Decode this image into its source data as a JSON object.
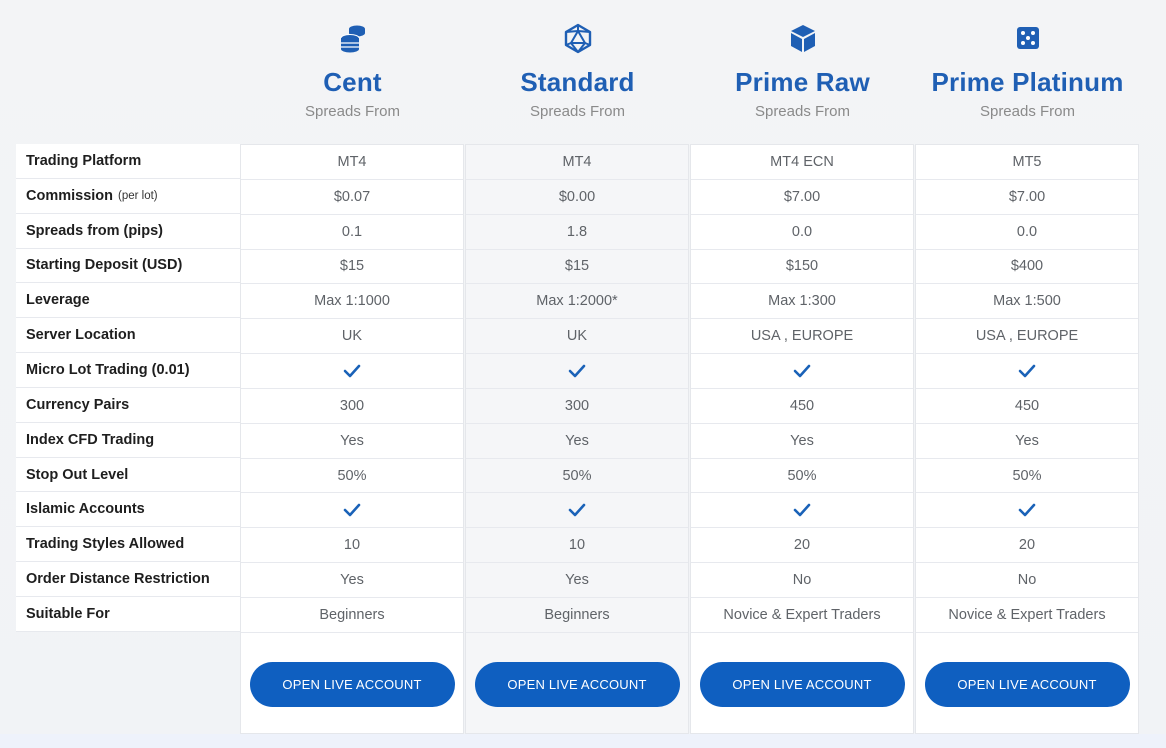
{
  "plans": [
    {
      "name": "Cent",
      "subtitle": "Spreads From",
      "icon": "coins-stack-icon",
      "cta": "OPEN LIVE ACCOUNT"
    },
    {
      "name": "Standard",
      "subtitle": "Spreads From",
      "icon": "polyhedron-icon",
      "cta": "OPEN LIVE ACCOUNT"
    },
    {
      "name": "Prime Raw",
      "subtitle": "Spreads From",
      "icon": "cube-icon",
      "cta": "OPEN LIVE ACCOUNT"
    },
    {
      "name": "Prime Platinum",
      "subtitle": "Spreads From",
      "icon": "dice-icon",
      "cta": "OPEN LIVE ACCOUNT"
    }
  ],
  "rows": [
    {
      "label": "Trading Platform",
      "note": "",
      "values": [
        "MT4",
        "MT4",
        "MT4 ECN",
        "MT5"
      ]
    },
    {
      "label": "Commission",
      "note": "(per lot)",
      "values": [
        "$0.07",
        "$0.00",
        "$7.00",
        "$7.00"
      ]
    },
    {
      "label": "Spreads from (pips)",
      "note": "",
      "values": [
        "0.1",
        "1.8",
        "0.0",
        "0.0"
      ]
    },
    {
      "label": "Starting Deposit (USD)",
      "note": "",
      "values": [
        "$15",
        "$15",
        "$150",
        "$400"
      ]
    },
    {
      "label": "Leverage",
      "note": "",
      "values": [
        "Max 1:1000",
        "Max 1:2000*",
        "Max 1:300",
        "Max 1:500"
      ]
    },
    {
      "label": "Server Location",
      "note": "",
      "values": [
        "UK",
        "UK",
        "USA , EUROPE",
        "USA , EUROPE"
      ]
    },
    {
      "label": "Micro Lot Trading (0.01)",
      "note": "",
      "values": [
        "check",
        "check",
        "check",
        "check"
      ]
    },
    {
      "label": "Currency Pairs",
      "note": "",
      "values": [
        "300",
        "300",
        "450",
        "450"
      ]
    },
    {
      "label": "Index CFD Trading",
      "note": "",
      "values": [
        "Yes",
        "Yes",
        "Yes",
        "Yes"
      ]
    },
    {
      "label": "Stop Out Level",
      "note": "",
      "values": [
        "50%",
        "50%",
        "50%",
        "50%"
      ]
    },
    {
      "label": "Islamic Accounts",
      "note": "",
      "values": [
        "check",
        "check",
        "check",
        "check"
      ]
    },
    {
      "label": "Trading Styles Allowed",
      "note": "",
      "values": [
        "10",
        "10",
        "20",
        "20"
      ]
    },
    {
      "label": "Order Distance Restriction",
      "note": "",
      "values": [
        "Yes",
        "Yes",
        "No",
        "No"
      ]
    },
    {
      "label": "Suitable For",
      "note": "",
      "values": [
        "Beginners",
        "Beginners",
        "Novice & Expert Traders",
        "Novice & Expert Traders"
      ]
    }
  ],
  "colors": {
    "brand": "#1f5fb4",
    "button": "#0f5fc0",
    "check": "#1a62b8"
  }
}
